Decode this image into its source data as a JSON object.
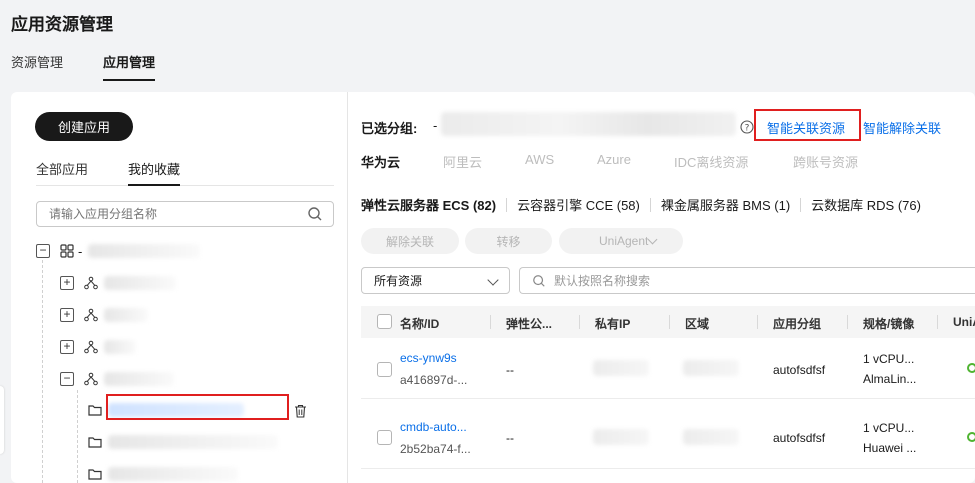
{
  "page": {
    "title": "应用资源管理"
  },
  "top_tabs": [
    {
      "label": "资源管理",
      "active": false
    },
    {
      "label": "应用管理",
      "active": true
    }
  ],
  "left": {
    "create_button": "创建应用",
    "tabs": [
      {
        "label": "全部应用",
        "active": false
      },
      {
        "label": "我的收藏",
        "active": true
      }
    ],
    "search_placeholder": "请输入应用分组名称",
    "root_prefix": "-"
  },
  "right": {
    "selected_group_label": "已选分组:",
    "selected_group_value": "-",
    "smart_link": "智能关联资源",
    "smart_unlink": "智能解除关联",
    "cloud_tabs": [
      "华为云",
      "阿里云",
      "AWS",
      "Azure",
      "IDC离线资源",
      "跨账号资源"
    ],
    "services": [
      {
        "label": "弹性云服务器 ECS (82)",
        "active": true
      },
      {
        "label": "云容器引擎 CCE (58)",
        "active": false
      },
      {
        "label": "裸金属服务器 BMS (1)",
        "active": false
      },
      {
        "label": "云数据库 RDS (76)",
        "active": false
      }
    ],
    "actions": {
      "unlink": "解除关联",
      "transfer": "转移",
      "uniagent": "UniAgent"
    },
    "filter_select": "所有资源",
    "search_placeholder": "默认按照名称搜索",
    "columns": [
      "名称/ID",
      "弹性公...",
      "私有IP",
      "区域",
      "应用分组",
      "规格/镜像",
      "UniA"
    ],
    "rows": [
      {
        "name": "ecs-ynw9s",
        "id": "a416897d-...",
        "eip": "--",
        "group": "autofsdfsf",
        "spec": "1 vCPU...",
        "image": "AlmaLin..."
      },
      {
        "name": "cmdb-auto...",
        "id": "2b52ba74-f...",
        "eip": "--",
        "group": "autofsdfsf",
        "spec": "1 vCPU...",
        "image": "Huawei ..."
      }
    ]
  },
  "colors": {
    "accent": "#0a6fe8",
    "highlight": "#e01f1f",
    "status_ok": "#50b432"
  }
}
